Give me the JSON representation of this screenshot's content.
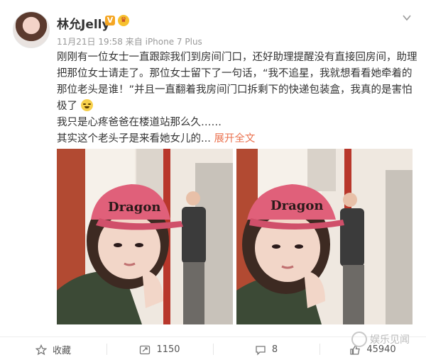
{
  "user": {
    "name": "林允Jelly",
    "verified_badge": "V",
    "member_icon": "crown-icon"
  },
  "meta": {
    "date": "11月21日 19:58",
    "source_prefix": "来自",
    "source": "iPhone 7 Plus"
  },
  "post": {
    "line1": "刚刚有一位女士一直跟踪我们到房间门口，还好助理提醒没有直接回房间，助理把那位女士请走了。那位女士留下了一句话，“我不追星，我就想看看她牵着的那位老头是谁！”并且一直翻着我房间门口拆剩下的快递包装盒，我真的是害怕极了",
    "line2": "我只是心疼爸爸在楼道站那么久……",
    "line3": "其实这个老头子是来看她女儿的...",
    "expand": "展开全文",
    "emoji": "laugh-cry-emoji"
  },
  "photos": {
    "cap_text": "Dragon"
  },
  "actions": {
    "favorite": "收藏",
    "repost": "1150",
    "comment": "8",
    "like": "45940"
  },
  "watermark": "娱乐见闻",
  "colors": {
    "link": "#eb7350",
    "cap": "#e0607a",
    "badge": "#f5a623"
  }
}
